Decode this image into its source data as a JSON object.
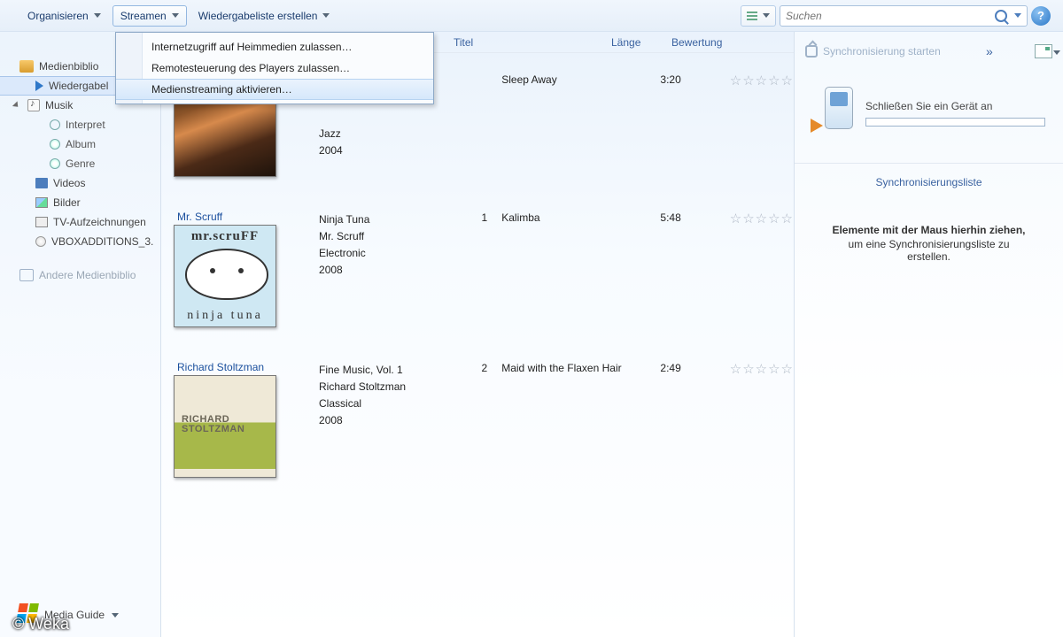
{
  "toolbar": {
    "organize": "Organisieren",
    "stream": "Streamen",
    "create_playlist": "Wiedergabeliste erstellen",
    "search_placeholder": "Suchen",
    "help_glyph": "?"
  },
  "stream_menu": {
    "items": [
      "Internetzugriff auf Heimmedien zulassen…",
      "Remotesteuerung des Players zulassen…",
      "Medienstreaming aktivieren…"
    ],
    "hover_index": 2
  },
  "sidebar": {
    "items": [
      {
        "label": "Medienbiblio"
      },
      {
        "label": "Wiedergabel"
      },
      {
        "label": "Musik"
      },
      {
        "label": "Interpret"
      },
      {
        "label": "Album"
      },
      {
        "label": "Genre"
      },
      {
        "label": "Videos"
      },
      {
        "label": "Bilder"
      },
      {
        "label": "TV-Aufzeichnungen"
      },
      {
        "label": "VBOXADDITIONS_3."
      },
      {
        "label": "Andere Medienbiblio"
      }
    ],
    "media_guide": "Media Guide"
  },
  "columns": {
    "title": "Titel",
    "length": "Länge",
    "rating": "Bewertung"
  },
  "albums": [
    {
      "artist": "",
      "album": "",
      "albumGenre": "Jazz",
      "albumYear": "2004",
      "trackNo": "",
      "trackTitle": "Sleep Away",
      "trackLen": "3:20",
      "cover": "bob"
    },
    {
      "artist": "Mr. Scruff",
      "album": "Ninja Tuna",
      "albumArtist": "Mr. Scruff",
      "albumGenre": "Electronic",
      "albumYear": "2008",
      "trackNo": "1",
      "trackTitle": "Kalimba",
      "trackLen": "5:48",
      "cover": "ninja",
      "coverText1": "mr.scruFF",
      "coverText2": "ninja tuna"
    },
    {
      "artist": "Richard Stoltzman",
      "album": "Fine Music, Vol. 1",
      "albumArtist": "Richard Stoltzman",
      "albumGenre": "Classical",
      "albumYear": "2008",
      "trackNo": "2",
      "trackTitle": "Maid with the Flaxen Hair",
      "trackLen": "2:49",
      "cover": "rich",
      "coverText1": "RICHARD",
      "coverText2": "STOLTZMAN"
    }
  ],
  "rating_glyph": "☆☆☆☆☆",
  "sync": {
    "start": "Synchronisierung starten",
    "chevrons": "»",
    "connect": "Schließen Sie ein Gerät an",
    "list_title": "Synchronisierungsliste",
    "drop_bold": "Elemente mit der Maus hierhin ziehen,",
    "drop_rest": "um eine Synchronisierungsliste zu erstellen."
  },
  "copyright": "© Weka"
}
